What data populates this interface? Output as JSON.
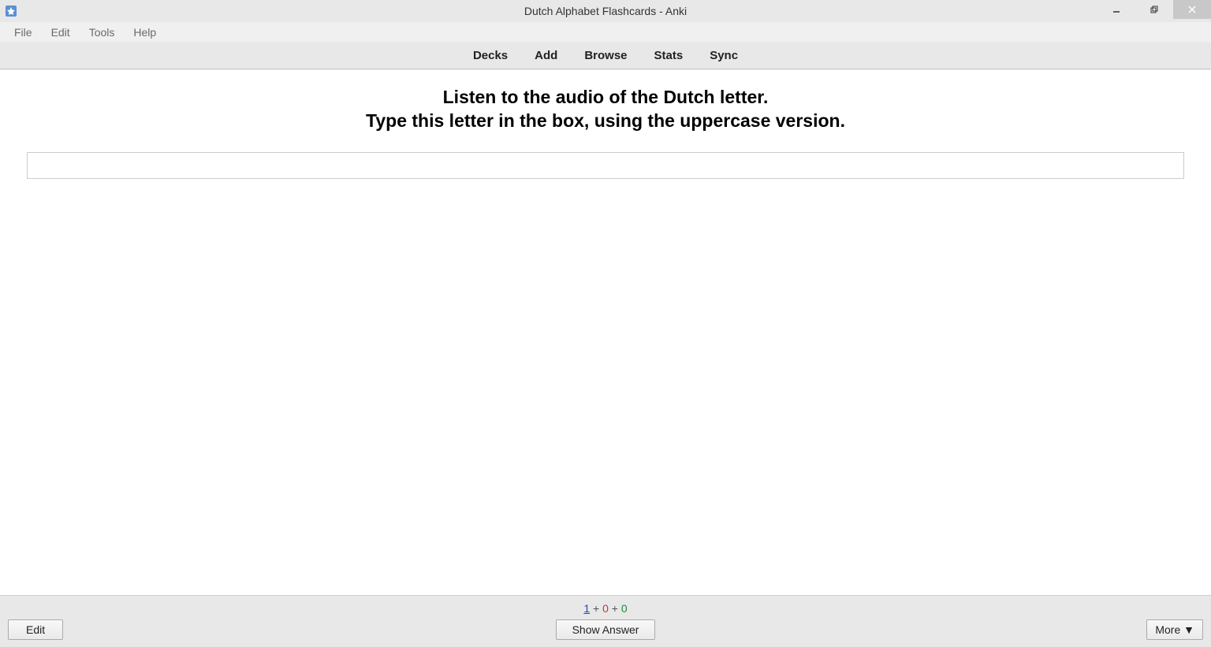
{
  "window": {
    "title": "Dutch Alphabet Flashcards - Anki"
  },
  "menubar": {
    "file": "File",
    "edit": "Edit",
    "tools": "Tools",
    "help": "Help"
  },
  "tabs": {
    "decks": "Decks",
    "add": "Add",
    "browse": "Browse",
    "stats": "Stats",
    "sync": "Sync"
  },
  "card": {
    "prompt_line1": "Listen to the audio of the Dutch letter.",
    "prompt_line2": "Type this letter in the box, using the uppercase version.",
    "answer_value": ""
  },
  "stats": {
    "new": "1",
    "learn": "0",
    "review": "0",
    "plus": " + "
  },
  "buttons": {
    "edit": "Edit",
    "show_answer": "Show Answer",
    "more": "More ▼"
  }
}
